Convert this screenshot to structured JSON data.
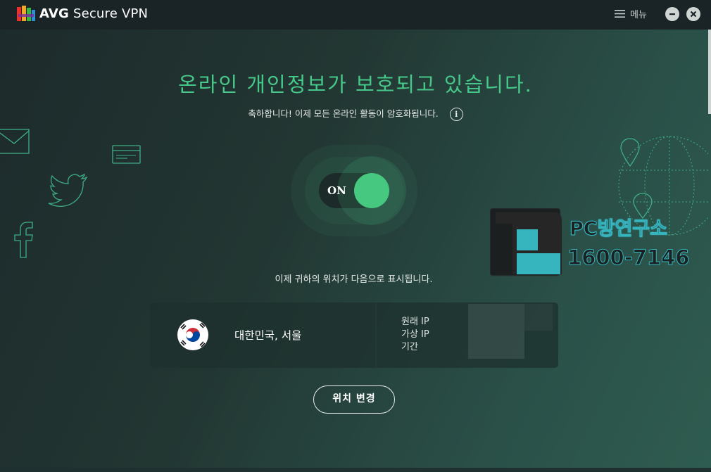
{
  "titlebar": {
    "brand": "AVG",
    "product": "Secure VPN",
    "menu_label": "메뉴"
  },
  "status": {
    "headline": "온라인 개인정보가 보호되고 있습니다.",
    "subline": "축하합니다! 이제 모든 온라인 활동이 암호화됩니다.",
    "info_glyph": "i"
  },
  "toggle": {
    "label": "ON",
    "state": "on",
    "accent_color": "#46c880"
  },
  "watermark": {
    "name": "PC방연구소",
    "phone": "1600-7146"
  },
  "location": {
    "caption": "이제 귀하의 위치가 다음으로 표시됩니다.",
    "country": "대한민국, 서울",
    "flag_icon": "south-korea-flag-icon",
    "ip_labels": [
      "원래 IP",
      "가상 IP",
      "기간"
    ]
  },
  "actions": {
    "change_location": "위치 변경"
  },
  "colors": {
    "headline": "#46c88a",
    "decor_outline": "#3fae86",
    "watermark_accent": "#37b5bf"
  }
}
